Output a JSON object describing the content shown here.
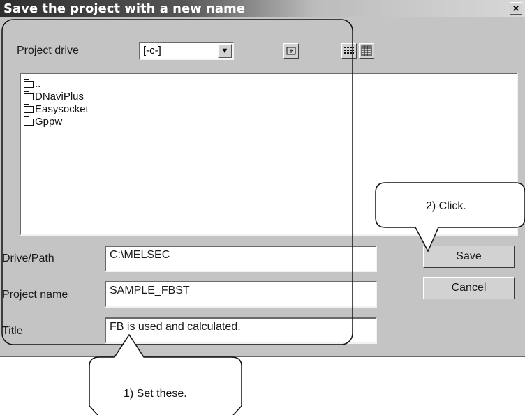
{
  "window": {
    "title": "Save the project with a new name",
    "close_glyph": "×"
  },
  "drive": {
    "label": "Project drive",
    "value": "[-c-]",
    "dropdown_arrow": "▼"
  },
  "folders": [
    "..",
    "DNaviPlus",
    "Easysocket",
    "Gppw"
  ],
  "fields": {
    "drive_path": {
      "label": "Drive/Path",
      "value": "C:\\MELSEC"
    },
    "project_name": {
      "label": "Project name",
      "value": "SAMPLE_FBST"
    },
    "title": {
      "label": "Title",
      "value": "FB is used and calculated."
    }
  },
  "buttons": {
    "save": "Save",
    "cancel": "Cancel"
  },
  "callouts": {
    "set_these": "1) Set these.",
    "click": "2) Click."
  },
  "icons": [
    "up-folder-icon",
    "list-view-icon",
    "details-view-icon",
    "folder-icon",
    "close-icon",
    "dropdown-arrow-icon"
  ]
}
